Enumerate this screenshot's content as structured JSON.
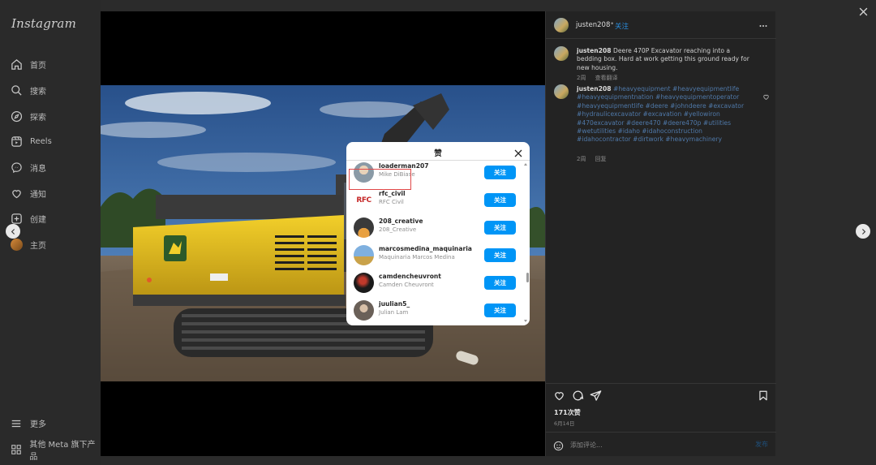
{
  "sidebar": {
    "logo": "Instagram",
    "items": [
      {
        "label": "首页",
        "icon": "home-icon"
      },
      {
        "label": "搜索",
        "icon": "search-icon"
      },
      {
        "label": "探索",
        "icon": "compass-icon"
      },
      {
        "label": "Reels",
        "icon": "reels-icon"
      },
      {
        "label": "消息",
        "icon": "messenger-icon"
      },
      {
        "label": "通知",
        "icon": "heart-icon"
      },
      {
        "label": "创建",
        "icon": "plus-square-icon"
      },
      {
        "label": "主页",
        "icon": "avatar"
      }
    ],
    "more": "更多",
    "meta": "其他 Meta 旗下产品"
  },
  "post": {
    "username": "justen208",
    "follow_label": "关注",
    "caption": {
      "username": "justen208",
      "text": "Deere 470P Excavator reaching into a bedding box. Hard at work getting this ground ready for new housing.",
      "time": "2周",
      "see_translation": "查看翻译"
    },
    "hashtag_comment": {
      "username": "justen208",
      "text": "#heavyequipment #heavyequipmentlife #heavyequipmentnation #heavyequipmentoperator #heavyequipmentlife #deere #johndeere #excavator #hydraulicexcavator #excavation #yellowiron #470excavator #deere470 #deere470p #utilities #wetutilities #idaho #idahoconstruction #idahocontractor #dirtwork #heavymachinery",
      "time": "2周",
      "reply": "回复"
    },
    "likes": "171次赞",
    "date": "6月14日",
    "comment_placeholder": "添加评论...",
    "post_label": "发布"
  },
  "likes_modal": {
    "title": "赞",
    "users": [
      {
        "username": "loaderman207",
        "name": "Mike DiBiase",
        "button": "关注"
      },
      {
        "username": "rfc_civil",
        "name": "RFC Civil",
        "button": "关注"
      },
      {
        "username": "208_creative",
        "name": "208_Creative",
        "button": "关注"
      },
      {
        "username": "marcosmedina_maquinaria",
        "name": "Maquinaria Marcos Medina",
        "button": "关注"
      },
      {
        "username": "camdencheuvront",
        "name": "Camden Cheuvront",
        "button": "关注"
      },
      {
        "username": "juulian5_",
        "name": "Julian Lam",
        "button": "关注"
      }
    ],
    "rfc_logo_text": "RFC"
  },
  "colors": {
    "follow_button": "#0095f6",
    "link_blue": "#2a8fe0",
    "highlight_red": "#e04848",
    "excavator_yellow": "#e8c21a"
  }
}
